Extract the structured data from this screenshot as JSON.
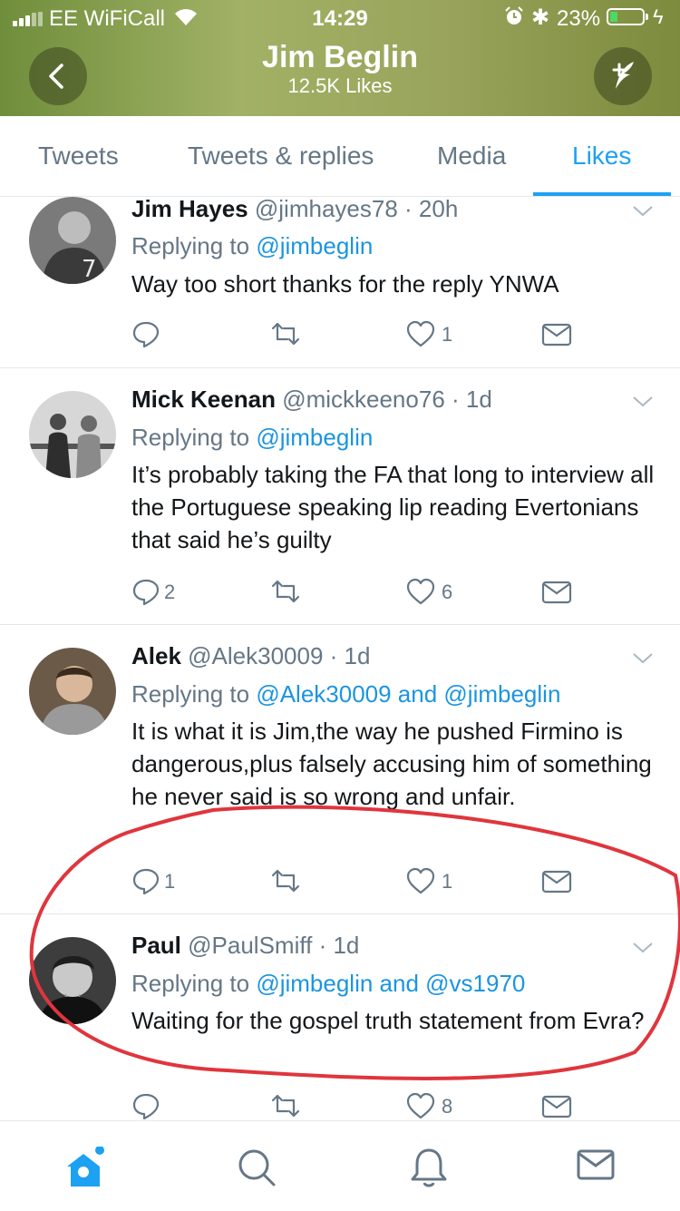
{
  "status_bar": {
    "carrier": "EE WiFiCall",
    "time": "14:29",
    "battery_percent": "23%",
    "battery_level": 0.23,
    "icons": [
      "signal-icon",
      "wifi-icon",
      "alarm-icon",
      "bluetooth-icon",
      "battery-icon",
      "charging-icon"
    ]
  },
  "header": {
    "title": "Jim Beglin",
    "subtitle": "12.5K Likes",
    "back_icon": "chevron-left-icon",
    "compose_icon": "compose-tweet-icon",
    "background": "#8fa552"
  },
  "tabs": [
    {
      "label": "Tweets",
      "active": false
    },
    {
      "label": "Tweets & replies",
      "active": false
    },
    {
      "label": "Media",
      "active": false
    },
    {
      "label": "Likes",
      "active": true
    }
  ],
  "tweets": [
    {
      "name": "Jim Hayes",
      "meta": "@jimhayes78 · 20h",
      "replying_prefix": "Replying to ",
      "replying_to": "@jimbeglin",
      "text": "Way too short thanks for the reply YNWA",
      "replies": "",
      "retweets": "",
      "likes": "1"
    },
    {
      "name": "Mick Keenan",
      "meta": "@mickkeeno76 · 1d",
      "replying_prefix": "Replying to ",
      "replying_to": "@jimbeglin",
      "text": "It’s probably taking the FA that long to interview all the Portuguese speaking lip reading Evertonians that said he’s guilty",
      "replies": "2",
      "retweets": "",
      "likes": "6"
    },
    {
      "name": "Alek",
      "meta": "@Alek30009 · 1d",
      "replying_prefix": "Replying to ",
      "replying_to": "@Alek30009 and @jimbeglin",
      "text": "It is what it is Jim,the way he pushed Firmino is dangerous,plus falsely accusing him of something he never said is so wrong and unfair.",
      "replies": "1",
      "retweets": "",
      "likes": "1"
    },
    {
      "name": "Paul",
      "meta": "@PaulSmiff · 1d",
      "replying_prefix": "Replying to ",
      "replying_to": "@jimbeglin and @vs1970",
      "text": "Waiting for the gospel truth statement from Evra?",
      "replies": "",
      "retweets": "",
      "likes": "8"
    }
  ],
  "bottom_nav": [
    {
      "icon": "home-icon",
      "active": true
    },
    {
      "icon": "search-icon",
      "active": false
    },
    {
      "icon": "notifications-icon",
      "active": false
    },
    {
      "icon": "messages-icon",
      "active": false
    }
  ],
  "colors": {
    "accent": "#1da1f2",
    "mention": "#1b95e0",
    "muted": "#657786",
    "annotation": "#e0353d"
  }
}
